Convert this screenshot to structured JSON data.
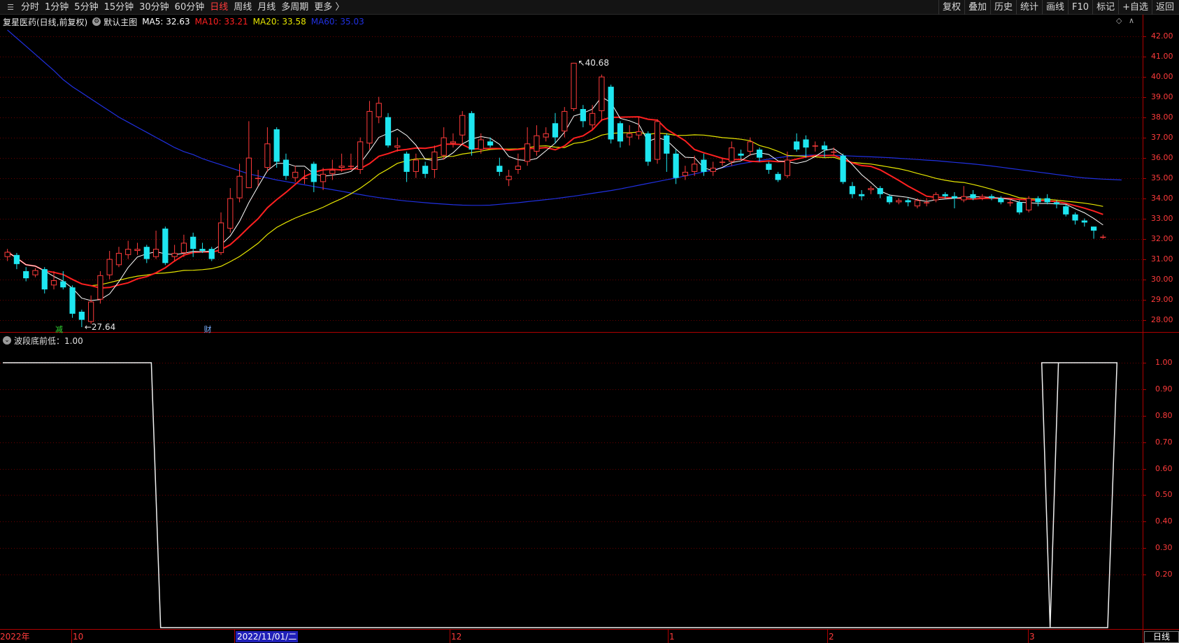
{
  "toolbar": {
    "left_items": [
      "分时",
      "1分钟",
      "5分钟",
      "15分钟",
      "30分钟",
      "60分钟",
      "日线",
      "周线",
      "月线",
      "多周期",
      "更多 〉"
    ],
    "active_item": "日线",
    "right_items": [
      "复权",
      "叠加",
      "历史",
      "统计",
      "画线",
      "F10",
      "标记",
      "+自选",
      "返回"
    ]
  },
  "header": {
    "stock": "复星医药(日线,前复权)",
    "main_chart": "默认主图",
    "ma5": "MA5: 32.63",
    "ma10": "MA10: 33.21",
    "ma20": "MA20: 33.58",
    "ma60": "MA60: 35.03"
  },
  "colors": {
    "up": "#ff3b3b",
    "down": "#1ee6f0",
    "ma5": "#ffffff",
    "ma10": "#ff2020",
    "ma20": "#e6e600",
    "ma60": "#2030e0",
    "axis": "#b00000",
    "grid": "#6a0000"
  },
  "indicator": {
    "label": "波段底前低：1.00"
  },
  "annotations": {
    "high_label": "40.68",
    "low_label": "27.64",
    "event1": "减",
    "event2": "财"
  },
  "x_axis_labels": [
    "2022年",
    "10",
    "2022/11/01/二",
    "12",
    "1",
    "2",
    "3"
  ],
  "period": "日线",
  "price_axis": [
    "42.00",
    "41.00",
    "40.00",
    "39.00",
    "38.00",
    "37.00",
    "36.00",
    "35.00",
    "34.00",
    "33.00",
    "32.00",
    "31.00",
    "30.00",
    "29.00",
    "28.00"
  ],
  "indicator_axis": [
    "1.00",
    "0.90",
    "0.80",
    "0.70",
    "0.60",
    "0.50",
    "0.40",
    "0.30",
    "0.20"
  ],
  "chart_data": {
    "type": "candlestick",
    "ylim": [
      27.4,
      42.4
    ],
    "candles": [
      {
        "o": 31.1,
        "c": 31.35,
        "h": 31.5,
        "l": 30.9
      },
      {
        "o": 31.2,
        "c": 30.75,
        "h": 31.3,
        "l": 30.5
      },
      {
        "o": 30.4,
        "c": 30.05,
        "h": 30.6,
        "l": 29.9
      },
      {
        "o": 30.2,
        "c": 30.45,
        "h": 30.55,
        "l": 30.1
      },
      {
        "o": 30.5,
        "c": 29.5,
        "h": 30.6,
        "l": 29.3
      },
      {
        "o": 29.7,
        "c": 29.95,
        "h": 30.4,
        "l": 29.5
      },
      {
        "o": 29.9,
        "c": 29.6,
        "h": 30.4,
        "l": 29.5
      },
      {
        "o": 29.6,
        "c": 28.3,
        "h": 29.7,
        "l": 28.1
      },
      {
        "o": 28.4,
        "c": 28.0,
        "h": 28.5,
        "l": 27.64
      },
      {
        "o": 27.9,
        "c": 28.9,
        "h": 29.2,
        "l": 27.8
      },
      {
        "o": 29.0,
        "c": 30.2,
        "h": 30.4,
        "l": 28.8
      },
      {
        "o": 30.2,
        "c": 31.0,
        "h": 31.4,
        "l": 30.0
      },
      {
        "o": 30.7,
        "c": 31.3,
        "h": 31.6,
        "l": 30.6
      },
      {
        "o": 31.2,
        "c": 31.5,
        "h": 31.9,
        "l": 31.0
      },
      {
        "o": 31.4,
        "c": 31.5,
        "h": 31.8,
        "l": 31.2
      },
      {
        "o": 31.6,
        "c": 31.0,
        "h": 31.7,
        "l": 30.8
      },
      {
        "o": 31.1,
        "c": 31.5,
        "h": 32.4,
        "l": 31.0
      },
      {
        "o": 32.5,
        "c": 30.8,
        "h": 32.6,
        "l": 30.7
      },
      {
        "o": 31.1,
        "c": 31.3,
        "h": 31.7,
        "l": 30.9
      },
      {
        "o": 31.3,
        "c": 31.8,
        "h": 32.2,
        "l": 31.1
      },
      {
        "o": 32.1,
        "c": 31.5,
        "h": 32.3,
        "l": 31.1
      },
      {
        "o": 31.5,
        "c": 31.4,
        "h": 31.8,
        "l": 31.3
      },
      {
        "o": 31.5,
        "c": 31.0,
        "h": 31.6,
        "l": 30.9
      },
      {
        "o": 31.3,
        "c": 32.8,
        "h": 33.3,
        "l": 31.2
      },
      {
        "o": 32.5,
        "c": 34.0,
        "h": 34.5,
        "l": 32.3
      },
      {
        "o": 34.0,
        "c": 35.1,
        "h": 35.7,
        "l": 33.8
      },
      {
        "o": 34.5,
        "c": 36.0,
        "h": 37.8,
        "l": 34.5
      },
      {
        "o": 35.0,
        "c": 35.0,
        "h": 35.4,
        "l": 34.6
      },
      {
        "o": 35.5,
        "c": 36.7,
        "h": 37.5,
        "l": 35.3
      },
      {
        "o": 37.4,
        "c": 35.8,
        "h": 37.5,
        "l": 35.5
      },
      {
        "o": 35.9,
        "c": 35.1,
        "h": 36.2,
        "l": 34.9
      },
      {
        "o": 35.0,
        "c": 35.3,
        "h": 35.6,
        "l": 34.8
      },
      {
        "o": 35.0,
        "c": 35.0,
        "h": 35.4,
        "l": 34.7
      },
      {
        "o": 35.7,
        "c": 34.8,
        "h": 35.8,
        "l": 34.3
      },
      {
        "o": 34.8,
        "c": 35.2,
        "h": 35.5,
        "l": 34.4
      },
      {
        "o": 35.2,
        "c": 35.4,
        "h": 35.9,
        "l": 34.9
      },
      {
        "o": 35.5,
        "c": 35.6,
        "h": 36.2,
        "l": 35.3
      },
      {
        "o": 35.6,
        "c": 35.6,
        "h": 36.2,
        "l": 35.4
      },
      {
        "o": 35.4,
        "c": 36.8,
        "h": 37.0,
        "l": 35.2
      },
      {
        "o": 36.7,
        "c": 38.3,
        "h": 38.8,
        "l": 36.4
      },
      {
        "o": 38.0,
        "c": 38.7,
        "h": 39.0,
        "l": 37.7
      },
      {
        "o": 38.0,
        "c": 36.6,
        "h": 38.2,
        "l": 36.5
      },
      {
        "o": 36.5,
        "c": 36.6,
        "h": 37.0,
        "l": 36.3
      },
      {
        "o": 36.2,
        "c": 35.3,
        "h": 36.3,
        "l": 34.8
      },
      {
        "o": 35.3,
        "c": 35.9,
        "h": 36.2,
        "l": 35.0
      },
      {
        "o": 35.6,
        "c": 35.2,
        "h": 35.8,
        "l": 35.0
      },
      {
        "o": 35.4,
        "c": 36.3,
        "h": 36.6,
        "l": 35.0
      },
      {
        "o": 36.1,
        "c": 37.0,
        "h": 37.5,
        "l": 35.9
      },
      {
        "o": 36.7,
        "c": 36.8,
        "h": 37.2,
        "l": 36.5
      },
      {
        "o": 37.1,
        "c": 38.1,
        "h": 38.3,
        "l": 36.7
      },
      {
        "o": 38.2,
        "c": 36.4,
        "h": 38.3,
        "l": 36.1
      },
      {
        "o": 36.4,
        "c": 36.9,
        "h": 37.2,
        "l": 36.2
      },
      {
        "o": 36.8,
        "c": 36.6,
        "h": 37.0,
        "l": 36.5
      },
      {
        "o": 35.6,
        "c": 35.3,
        "h": 36.0,
        "l": 35.1
      },
      {
        "o": 34.9,
        "c": 35.1,
        "h": 35.4,
        "l": 34.6
      },
      {
        "o": 35.4,
        "c": 35.6,
        "h": 36.2,
        "l": 35.2
      },
      {
        "o": 35.8,
        "c": 36.7,
        "h": 37.5,
        "l": 35.6
      },
      {
        "o": 36.3,
        "c": 37.1,
        "h": 37.6,
        "l": 36.1
      },
      {
        "o": 37.0,
        "c": 37.2,
        "h": 37.5,
        "l": 36.8
      },
      {
        "o": 37.7,
        "c": 37.0,
        "h": 38.2,
        "l": 36.7
      },
      {
        "o": 37.3,
        "c": 38.3,
        "h": 38.5,
        "l": 37.0
      },
      {
        "o": 38.4,
        "c": 40.68,
        "h": 40.68,
        "l": 38.3
      },
      {
        "o": 38.4,
        "c": 37.8,
        "h": 38.6,
        "l": 37.5
      },
      {
        "o": 37.6,
        "c": 38.2,
        "h": 38.6,
        "l": 37.4
      },
      {
        "o": 38.3,
        "c": 40.0,
        "h": 40.1,
        "l": 37.8
      },
      {
        "o": 39.5,
        "c": 36.9,
        "h": 39.6,
        "l": 36.7
      },
      {
        "o": 37.7,
        "c": 36.8,
        "h": 37.8,
        "l": 36.5
      },
      {
        "o": 37.0,
        "c": 37.2,
        "h": 37.6,
        "l": 36.6
      },
      {
        "o": 37.1,
        "c": 37.3,
        "h": 38.0,
        "l": 36.9
      },
      {
        "o": 37.2,
        "c": 35.8,
        "h": 37.3,
        "l": 35.6
      },
      {
        "o": 35.9,
        "c": 37.8,
        "h": 37.9,
        "l": 35.7
      },
      {
        "o": 37.1,
        "c": 36.2,
        "h": 37.2,
        "l": 35.3
      },
      {
        "o": 36.2,
        "c": 35.0,
        "h": 36.4,
        "l": 34.7
      },
      {
        "o": 35.1,
        "c": 35.3,
        "h": 35.6,
        "l": 34.9
      },
      {
        "o": 35.3,
        "c": 35.7,
        "h": 36.1,
        "l": 35.1
      },
      {
        "o": 35.9,
        "c": 35.3,
        "h": 36.2,
        "l": 35.1
      },
      {
        "o": 35.3,
        "c": 35.5,
        "h": 35.8,
        "l": 35.1
      },
      {
        "o": 35.8,
        "c": 35.8,
        "h": 36.0,
        "l": 35.6
      },
      {
        "o": 35.8,
        "c": 36.5,
        "h": 36.8,
        "l": 35.6
      },
      {
        "o": 36.2,
        "c": 36.1,
        "h": 36.4,
        "l": 35.9
      },
      {
        "o": 36.3,
        "c": 36.8,
        "h": 37.0,
        "l": 36.1
      },
      {
        "o": 36.4,
        "c": 36.0,
        "h": 36.5,
        "l": 35.8
      },
      {
        "o": 35.7,
        "c": 35.4,
        "h": 35.8,
        "l": 35.2
      },
      {
        "o": 35.2,
        "c": 34.9,
        "h": 35.3,
        "l": 34.8
      },
      {
        "o": 35.1,
        "c": 35.9,
        "h": 36.3,
        "l": 35.0
      },
      {
        "o": 36.8,
        "c": 36.4,
        "h": 37.2,
        "l": 36.3
      },
      {
        "o": 36.9,
        "c": 36.5,
        "h": 37.1,
        "l": 36.0
      },
      {
        "o": 36.6,
        "c": 36.6,
        "h": 36.8,
        "l": 36.3
      },
      {
        "o": 36.6,
        "c": 36.4,
        "h": 36.8,
        "l": 36.0
      },
      {
        "o": 36.3,
        "c": 36.3,
        "h": 36.5,
        "l": 36.1
      },
      {
        "o": 36.1,
        "c": 34.8,
        "h": 36.2,
        "l": 34.7
      },
      {
        "o": 34.6,
        "c": 34.2,
        "h": 34.8,
        "l": 34.0
      },
      {
        "o": 34.2,
        "c": 34.1,
        "h": 34.4,
        "l": 33.9
      },
      {
        "o": 34.4,
        "c": 34.5,
        "h": 34.6,
        "l": 34.2
      },
      {
        "o": 34.5,
        "c": 34.2,
        "h": 34.6,
        "l": 34.0
      },
      {
        "o": 34.1,
        "c": 33.8,
        "h": 34.2,
        "l": 33.7
      },
      {
        "o": 33.8,
        "c": 33.9,
        "h": 34.0,
        "l": 33.7
      },
      {
        "o": 33.9,
        "c": 33.8,
        "h": 34.0,
        "l": 33.6
      },
      {
        "o": 33.6,
        "c": 33.9,
        "h": 34.0,
        "l": 33.5
      },
      {
        "o": 33.8,
        "c": 33.8,
        "h": 34.0,
        "l": 33.6
      },
      {
        "o": 33.9,
        "c": 34.2,
        "h": 34.3,
        "l": 33.8
      },
      {
        "o": 34.2,
        "c": 34.1,
        "h": 34.3,
        "l": 34.0
      },
      {
        "o": 34.1,
        "c": 34.0,
        "h": 34.3,
        "l": 33.5
      },
      {
        "o": 33.9,
        "c": 34.1,
        "h": 34.6,
        "l": 33.8
      },
      {
        "o": 34.2,
        "c": 34.0,
        "h": 34.4,
        "l": 33.9
      },
      {
        "o": 34.0,
        "c": 34.1,
        "h": 34.2,
        "l": 33.9
      },
      {
        "o": 34.1,
        "c": 34.0,
        "h": 34.2,
        "l": 33.9
      },
      {
        "o": 34.0,
        "c": 33.8,
        "h": 34.1,
        "l": 33.7
      },
      {
        "o": 33.8,
        "c": 33.8,
        "h": 34.0,
        "l": 33.6
      },
      {
        "o": 33.8,
        "c": 33.3,
        "h": 33.9,
        "l": 33.2
      },
      {
        "o": 33.4,
        "c": 34.0,
        "h": 34.1,
        "l": 33.3
      },
      {
        "o": 34.0,
        "c": 33.8,
        "h": 34.1,
        "l": 33.6
      },
      {
        "o": 34.0,
        "c": 33.8,
        "h": 34.2,
        "l": 33.7
      },
      {
        "o": 33.8,
        "c": 33.7,
        "h": 33.9,
        "l": 33.5
      },
      {
        "o": 33.6,
        "c": 33.2,
        "h": 33.7,
        "l": 33.1
      },
      {
        "o": 33.2,
        "c": 32.9,
        "h": 33.3,
        "l": 32.7
      },
      {
        "o": 32.9,
        "c": 32.8,
        "h": 33.0,
        "l": 32.6
      },
      {
        "o": 32.6,
        "c": 32.4,
        "h": 32.6,
        "l": 32.0
      },
      {
        "o": 32.1,
        "c": 32.1,
        "h": 32.2,
        "l": 32.0
      }
    ],
    "ma60": [
      42.3,
      41.9,
      41.5,
      41.1,
      40.7,
      40.3,
      39.85,
      39.5,
      39.2,
      38.9,
      38.6,
      38.3,
      38.0,
      37.75,
      37.5,
      37.25,
      37.0,
      36.75,
      36.5,
      36.3,
      36.15,
      35.95,
      35.8,
      35.65,
      35.5,
      35.35,
      35.2,
      35.1,
      35.0,
      34.9,
      34.82,
      34.74,
      34.66,
      34.58,
      34.5,
      34.42,
      34.34,
      34.26,
      34.18,
      34.1,
      34.03,
      33.97,
      33.91,
      33.86,
      33.82,
      33.78,
      33.74,
      33.71,
      33.68,
      33.66,
      33.65,
      33.65,
      33.66,
      33.7,
      33.74,
      33.78,
      33.83,
      33.88,
      33.93,
      33.98,
      34.04,
      34.1,
      34.17,
      34.24,
      34.31,
      34.38,
      34.46,
      34.55,
      34.64,
      34.73,
      34.82,
      34.91,
      35.0,
      35.1,
      35.2,
      35.3,
      35.4,
      35.5,
      35.6,
      35.7,
      35.78,
      35.86,
      35.93,
      36.0,
      36.06,
      36.1,
      36.12,
      36.13,
      36.13,
      36.12,
      36.1,
      36.08,
      36.06,
      36.04,
      36.02,
      36.0,
      35.97,
      35.94,
      35.91,
      35.88,
      35.85,
      35.81,
      35.77,
      35.73,
      35.69,
      35.64,
      35.59,
      35.53,
      35.47,
      35.41,
      35.35,
      35.29,
      35.23,
      35.17,
      35.11,
      35.05,
      35.0,
      34.97,
      34.94,
      34.92,
      34.9
    ],
    "indicator_series": [
      1,
      1,
      1,
      1,
      1,
      1,
      1,
      1,
      1,
      1,
      1,
      1,
      1,
      1,
      1,
      1,
      0,
      0,
      0,
      0,
      0,
      0,
      0,
      0,
      0,
      0,
      0,
      0,
      0,
      0,
      0,
      0,
      0,
      0,
      0,
      0,
      0,
      0,
      0,
      0,
      0,
      0,
      0,
      0,
      0,
      0,
      0,
      0,
      0,
      0,
      0,
      0,
      0,
      0,
      0,
      0,
      0,
      0,
      0,
      0,
      0,
      0,
      0,
      0,
      0,
      0,
      0,
      0,
      0,
      0,
      0,
      0,
      0,
      0,
      0,
      0,
      0,
      0,
      0,
      0,
      0,
      0,
      0,
      0,
      0,
      0,
      0,
      0,
      0,
      0,
      0,
      0,
      0,
      0,
      0,
      0,
      0,
      0,
      0,
      0,
      0,
      0,
      0,
      0,
      0,
      0,
      0,
      0,
      0,
      0,
      0,
      0,
      0,
      0,
      0,
      0,
      0,
      0,
      0,
      1,
      1
    ],
    "indicator_ylim": [
      0,
      1.05
    ]
  }
}
